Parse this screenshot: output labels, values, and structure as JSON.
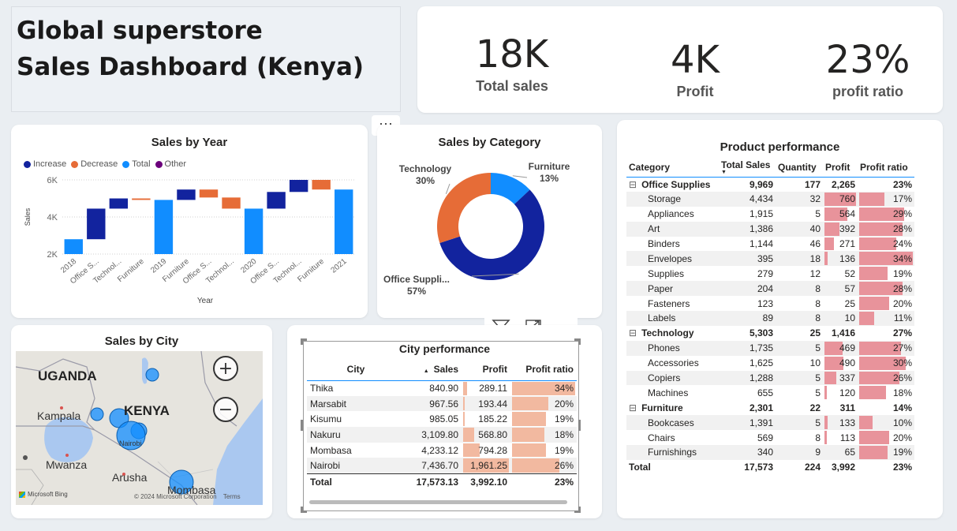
{
  "header": {
    "title_line1": "Global superstore",
    "title_line2": "Sales Dashboard (Kenya)"
  },
  "kpis": [
    {
      "value": "18K",
      "label": "Total sales"
    },
    {
      "value": "4K",
      "label": "Profit"
    },
    {
      "value": "23%",
      "label": "profit ratio"
    }
  ],
  "chart_data": [
    {
      "type": "bar",
      "subtype": "waterfall",
      "title": "Sales by Year",
      "xlabel": "Year",
      "ylabel": "Sales",
      "ylim": [
        2000,
        6000
      ],
      "y_ticks": [
        "2K",
        "4K",
        "6K"
      ],
      "legend": [
        "Increase",
        "Decrease",
        "Total",
        "Other"
      ],
      "legend_colors": {
        "Increase": "#12239e",
        "Decrease": "#e66c37",
        "Total": "#118dff",
        "Other": "#6b007b"
      },
      "categories": [
        "2018",
        "Office S...",
        "Technol...",
        "Furniture",
        "2019",
        "Furniture",
        "Office S...",
        "Technol...",
        "2020",
        "Office S...",
        "Technol...",
        "Furniture",
        "2021"
      ],
      "bars": [
        {
          "kind": "Total",
          "start": 2000,
          "end": 2800
        },
        {
          "kind": "Increase",
          "start": 2800,
          "end": 4450
        },
        {
          "kind": "Increase",
          "start": 4450,
          "end": 5000
        },
        {
          "kind": "Decrease",
          "start": 5000,
          "end": 4920
        },
        {
          "kind": "Total",
          "start": 2000,
          "end": 4920
        },
        {
          "kind": "Increase",
          "start": 4920,
          "end": 5480
        },
        {
          "kind": "Decrease",
          "start": 5480,
          "end": 5050
        },
        {
          "kind": "Decrease",
          "start": 5050,
          "end": 4450
        },
        {
          "kind": "Total",
          "start": 2000,
          "end": 4450
        },
        {
          "kind": "Increase",
          "start": 4450,
          "end": 5350
        },
        {
          "kind": "Increase",
          "start": 5350,
          "end": 6000
        },
        {
          "kind": "Decrease",
          "start": 6000,
          "end": 5480
        },
        {
          "kind": "Total",
          "start": 2000,
          "end": 5480
        }
      ]
    },
    {
      "type": "pie",
      "subtype": "donut",
      "title": "Sales by Category",
      "categories": [
        "Office Suppli...",
        "Technology",
        "Furniture"
      ],
      "values": [
        57,
        30,
        13
      ],
      "labels": [
        "57%",
        "30%",
        "13%"
      ],
      "colors": [
        "#12239e",
        "#e66c37",
        "#118dff"
      ]
    }
  ],
  "sales_by_city": {
    "title": "Sales by City",
    "labels": {
      "uganda": "UGANDA",
      "kenya": "KENYA",
      "kampala": "Kampala",
      "mwanza": "Mwanza",
      "arusha": "Arusha",
      "nairobi": "Nairobi",
      "mombasa": "Mombasa"
    },
    "zoom_in": "+",
    "zoom_out": "−",
    "attribution": "Microsoft Bing",
    "copyright": "© 2024 Microsoft Corporation",
    "terms": "Terms"
  },
  "city_performance": {
    "title": "City performance",
    "columns": [
      "City",
      "Sales",
      "Profit",
      "Profit ratio"
    ],
    "rows": [
      {
        "city": "Thika",
        "sales": "840.90",
        "profit": "289.11",
        "ratio": "34%",
        "profit_fill": 0.15,
        "ratio_fill": 1.0
      },
      {
        "city": "Marsabit",
        "sales": "967.56",
        "profit": "193.44",
        "ratio": "20%",
        "profit_fill": 0.1,
        "ratio_fill": 0.59
      },
      {
        "city": "Kisumu",
        "sales": "985.05",
        "profit": "185.22",
        "ratio": "19%",
        "profit_fill": 0.09,
        "ratio_fill": 0.56
      },
      {
        "city": "Nakuru",
        "sales": "3,109.80",
        "profit": "568.80",
        "ratio": "18%",
        "profit_fill": 0.29,
        "ratio_fill": 0.53
      },
      {
        "city": "Mombasa",
        "sales": "4,233.12",
        "profit": "794.28",
        "ratio": "19%",
        "profit_fill": 0.4,
        "ratio_fill": 0.56
      },
      {
        "city": "Nairobi",
        "sales": "7,436.70",
        "profit": "1,961.25",
        "ratio": "26%",
        "profit_fill": 1.0,
        "ratio_fill": 0.76
      }
    ],
    "total": {
      "label": "Total",
      "sales": "17,573.13",
      "profit": "3,992.10",
      "ratio": "23%"
    }
  },
  "product_performance": {
    "title": "Product performance",
    "columns": [
      "Category",
      "Total Sales",
      "Quantity",
      "Profit",
      "Profit ratio"
    ],
    "rows": [
      {
        "type": "cat",
        "name": "Office Supplies",
        "sales": "9,969",
        "qty": "177",
        "profit": "2,265",
        "ratio": "23%"
      },
      {
        "type": "sub",
        "name": "Storage",
        "sales": "4,434",
        "qty": "32",
        "profit": "760",
        "ratio": "17%",
        "profit_fill": 1.0,
        "ratio_fill": 0.5
      },
      {
        "type": "sub",
        "name": "Appliances",
        "sales": "1,915",
        "qty": "5",
        "profit": "564",
        "ratio": "29%",
        "profit_fill": 0.74,
        "ratio_fill": 0.85
      },
      {
        "type": "sub",
        "name": "Art",
        "sales": "1,386",
        "qty": "40",
        "profit": "392",
        "ratio": "28%",
        "profit_fill": 0.52,
        "ratio_fill": 0.82
      },
      {
        "type": "sub",
        "name": "Binders",
        "sales": "1,144",
        "qty": "46",
        "profit": "271",
        "ratio": "24%",
        "profit_fill": 0.36,
        "ratio_fill": 0.71
      },
      {
        "type": "sub",
        "name": "Envelopes",
        "sales": "395",
        "qty": "18",
        "profit": "136",
        "ratio": "34%",
        "profit_fill": 0.18,
        "ratio_fill": 1.0
      },
      {
        "type": "sub",
        "name": "Supplies",
        "sales": "279",
        "qty": "12",
        "profit": "52",
        "ratio": "19%",
        "profit_fill": 0.07,
        "ratio_fill": 0.56
      },
      {
        "type": "sub",
        "name": "Paper",
        "sales": "204",
        "qty": "8",
        "profit": "57",
        "ratio": "28%",
        "profit_fill": 0.08,
        "ratio_fill": 0.82
      },
      {
        "type": "sub",
        "name": "Fasteners",
        "sales": "123",
        "qty": "8",
        "profit": "25",
        "ratio": "20%",
        "profit_fill": 0.03,
        "ratio_fill": 0.59
      },
      {
        "type": "sub",
        "name": "Labels",
        "sales": "89",
        "qty": "8",
        "profit": "10",
        "ratio": "11%",
        "profit_fill": 0.01,
        "ratio_fill": 0.32
      },
      {
        "type": "cat",
        "name": "Technology",
        "sales": "5,303",
        "qty": "25",
        "profit": "1,416",
        "ratio": "27%"
      },
      {
        "type": "sub",
        "name": "Phones",
        "sales": "1,735",
        "qty": "5",
        "profit": "469",
        "ratio": "27%",
        "profit_fill": 0.62,
        "ratio_fill": 0.79
      },
      {
        "type": "sub",
        "name": "Accessories",
        "sales": "1,625",
        "qty": "10",
        "profit": "490",
        "ratio": "30%",
        "profit_fill": 0.64,
        "ratio_fill": 0.88
      },
      {
        "type": "sub",
        "name": "Copiers",
        "sales": "1,288",
        "qty": "5",
        "profit": "337",
        "ratio": "26%",
        "profit_fill": 0.44,
        "ratio_fill": 0.76
      },
      {
        "type": "sub",
        "name": "Machines",
        "sales": "655",
        "qty": "5",
        "profit": "120",
        "ratio": "18%",
        "profit_fill": 0.16,
        "ratio_fill": 0.53
      },
      {
        "type": "cat",
        "name": "Furniture",
        "sales": "2,301",
        "qty": "22",
        "profit": "311",
        "ratio": "14%"
      },
      {
        "type": "sub",
        "name": "Bookcases",
        "sales": "1,391",
        "qty": "5",
        "profit": "133",
        "ratio": "10%",
        "profit_fill": 0.18,
        "ratio_fill": 0.29
      },
      {
        "type": "sub",
        "name": "Chairs",
        "sales": "569",
        "qty": "8",
        "profit": "113",
        "ratio": "20%",
        "profit_fill": 0.15,
        "ratio_fill": 0.59
      },
      {
        "type": "sub",
        "name": "Furnishings",
        "sales": "340",
        "qty": "9",
        "profit": "65",
        "ratio": "19%",
        "profit_fill": 0.09,
        "ratio_fill": 0.56
      },
      {
        "type": "total",
        "name": "Total",
        "sales": "17,573",
        "qty": "224",
        "profit": "3,992",
        "ratio": "23%"
      }
    ]
  }
}
